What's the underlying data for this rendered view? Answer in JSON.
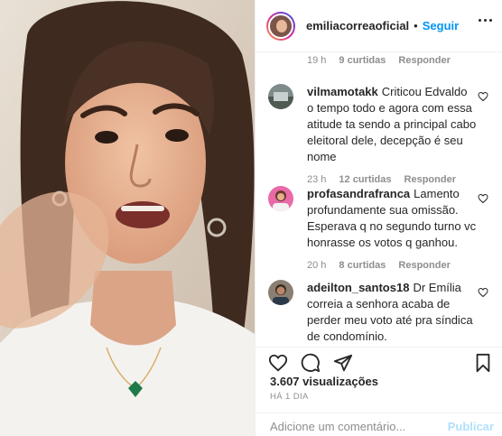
{
  "post": {
    "username": "emiliacorreaoficial",
    "follow_label": "Seguir",
    "separator": "•",
    "views": "3.607 visualizações",
    "date": "HÁ 1 DIA"
  },
  "comments": {
    "first_meta": {
      "time": "19 h",
      "likes": "9 curtidas",
      "reply": "Responder"
    },
    "items": [
      {
        "username": "vilmamotakk",
        "text": "Criticou Edvaldo o tempo todo e agora com essa atitude ta sendo a principal cabo eleitoral dele, decepção é seu nome",
        "time": "23 h",
        "likes": "12 curtidas",
        "reply": "Responder"
      },
      {
        "username": "profasandrafranca",
        "text": "Lamento profundamente sua omissão. Esperava q no segundo turno vc honrasse os votos q ganhou.",
        "time": "20 h",
        "likes": "8 curtidas",
        "reply": "Responder"
      },
      {
        "username": "adeilton_santos18",
        "text": "Dr Emília correia a senhora acaba de perder meu voto até pra síndica de condomínio."
      }
    ]
  },
  "add_comment": {
    "placeholder": "Adicione um comentário...",
    "publish_label": "Publicar"
  },
  "icons": {
    "like": "heart-icon",
    "comment": "comment-icon",
    "share": "paper-plane-icon",
    "save": "bookmark-icon",
    "more": "more-options-icon"
  },
  "colors": {
    "accent": "#0095f6",
    "publish_disabled": "#b2dffc",
    "muted": "#8e8e8e",
    "text": "#262626"
  }
}
